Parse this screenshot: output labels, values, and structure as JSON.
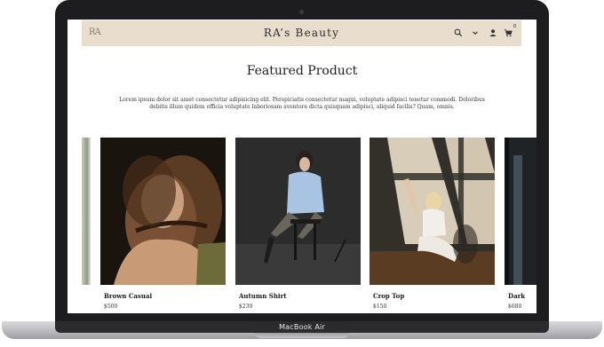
{
  "device": {
    "label": "MacBook Air"
  },
  "header": {
    "logo": "RA",
    "title": "RA’s Beauty",
    "cart_count": "0",
    "icons": [
      "search-icon",
      "chevron-down-icon",
      "user-icon",
      "cart-icon"
    ]
  },
  "featured": {
    "title": "Featured Product",
    "description": "Lorem ipsum dolor sit amet consectetur adipisicing elit. Perspiciatis consectetur magni, voluptate adipisci tenetur commodi. Doloribus debitis illum quidem officia voluptate laboriosam aventore dicta quisquam adipisci, aliquid facilis? Quam, omnis."
  },
  "products": [
    {
      "name": "Brown Casual",
      "price": "$500"
    },
    {
      "name": "Autumn Shirt",
      "price": "$230"
    },
    {
      "name": "Crop Top",
      "price": "$150"
    },
    {
      "name": "Dark",
      "price": "$680"
    }
  ],
  "colors": {
    "header_bg": "#e9ddcd",
    "frame": "#1d1d1f"
  }
}
